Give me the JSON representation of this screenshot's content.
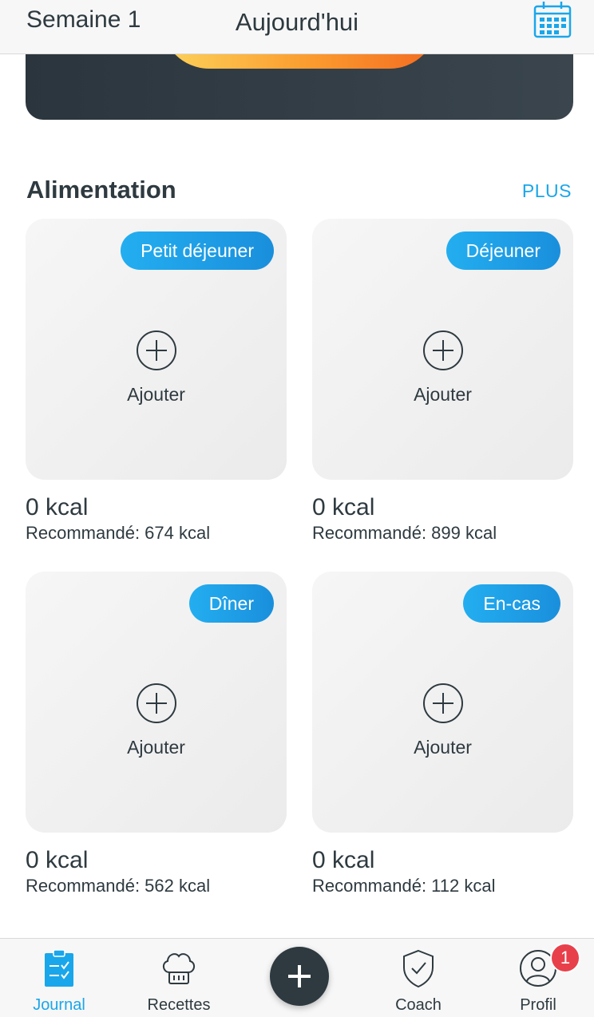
{
  "header": {
    "week_label": "Semaine 1",
    "title": "Aujourd'hui",
    "calendar_icon": "calendar-icon"
  },
  "colors": {
    "accent": "#1aa6ea",
    "dark": "#2e3a40",
    "badge": "#e8404b",
    "hero_gradient": [
      "#fdd35a",
      "#f36b21"
    ]
  },
  "section": {
    "title": "Alimentation",
    "more_label": "PLUS"
  },
  "meals": [
    {
      "tag": "Petit déjeuner",
      "add_label": "Ajouter",
      "kcal": "0 kcal",
      "recommended": "Recommandé: 674 kcal"
    },
    {
      "tag": "Déjeuner",
      "add_label": "Ajouter",
      "kcal": "0 kcal",
      "recommended": "Recommandé: 899 kcal"
    },
    {
      "tag": "Dîner",
      "add_label": "Ajouter",
      "kcal": "0 kcal",
      "recommended": "Recommandé: 562 kcal"
    },
    {
      "tag": "En-cas",
      "add_label": "Ajouter",
      "kcal": "0 kcal",
      "recommended": "Recommandé: 112 kcal"
    }
  ],
  "nav": {
    "items": [
      {
        "label": "Journal",
        "icon": "clipboard-check-icon",
        "active": true
      },
      {
        "label": "Recettes",
        "icon": "chef-hat-icon",
        "active": false
      },
      {
        "label": "",
        "icon": "plus-icon",
        "active": false
      },
      {
        "label": "Coach",
        "icon": "shield-check-icon",
        "active": false
      },
      {
        "label": "Profil",
        "icon": "user-icon",
        "active": false
      }
    ],
    "profile_badge": "1"
  }
}
